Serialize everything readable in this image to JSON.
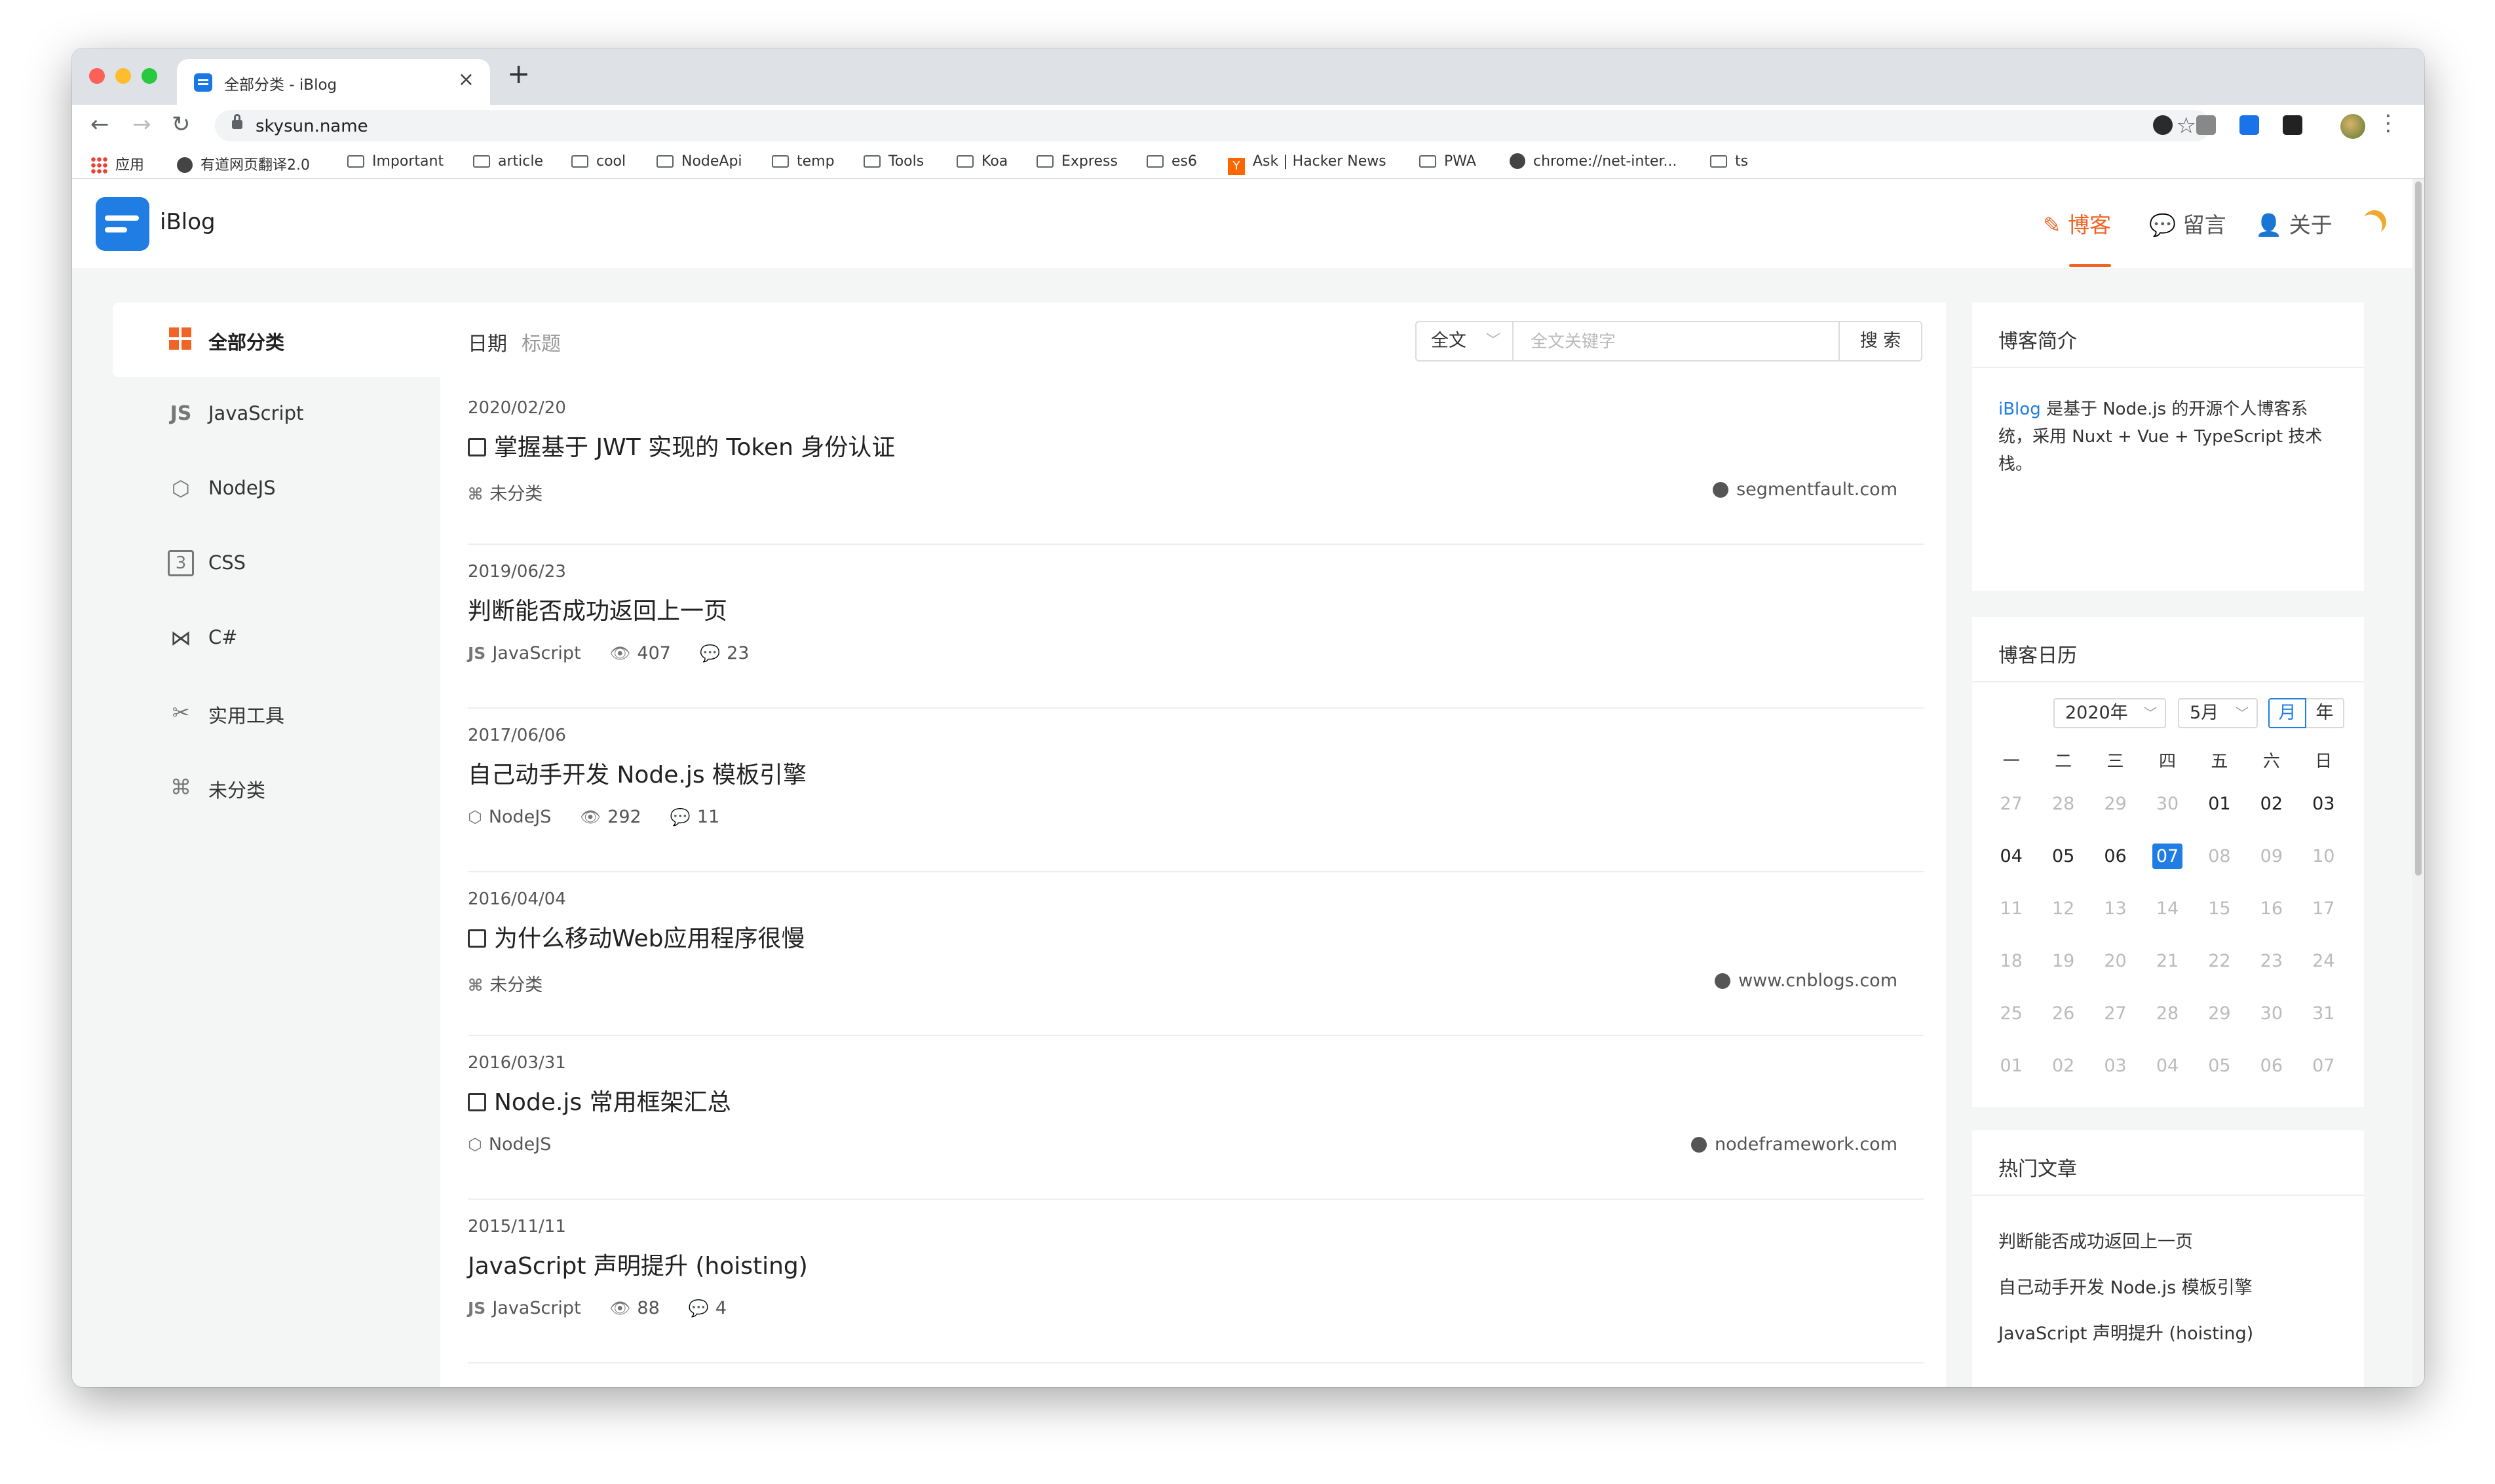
{
  "browser": {
    "tab_title": "全部分类 - iBlog",
    "url": "skysun.name",
    "bookmarks": [
      "应用",
      "有道网页翻译2.0",
      "Important",
      "article",
      "cool",
      "NodeApi",
      "temp",
      "Tools",
      "Koa",
      "Express",
      "es6",
      "Ask | Hacker News",
      "PWA",
      "chrome://net-inter...",
      "ts"
    ]
  },
  "header": {
    "brand": "iBlog",
    "nav": [
      {
        "label": "博客",
        "icon": "feather-icon",
        "active": true
      },
      {
        "label": "留言",
        "icon": "comment-icon",
        "active": false
      },
      {
        "label": "关于",
        "icon": "user-icon",
        "active": false
      }
    ],
    "theme_icon": "moon-icon"
  },
  "sidebar": {
    "items": [
      {
        "label": "全部分类",
        "icon": "grid-icon",
        "active": true
      },
      {
        "label": "JavaScript",
        "icon": "js-icon",
        "active": false
      },
      {
        "label": "NodeJS",
        "icon": "nodejs-icon",
        "active": false
      },
      {
        "label": "CSS",
        "icon": "css3-icon",
        "active": false
      },
      {
        "label": "C#",
        "icon": "visual-studio-icon",
        "active": false
      },
      {
        "label": "实用工具",
        "icon": "tools-icon",
        "active": false
      },
      {
        "label": "未分类",
        "icon": "grid-outline-icon",
        "active": false
      }
    ]
  },
  "list": {
    "col_date": "日期",
    "col_title": "标题",
    "search_scope": "全文",
    "search_placeholder": "全文关键字",
    "search_button": "搜 索",
    "articles": [
      {
        "date": "2020/02/20",
        "title": "掌握基于 JWT 实现的 Token 身份认证",
        "external": true,
        "category": "未分类",
        "category_icon": "grid-outline-icon",
        "views": "",
        "comments": "",
        "source": "segmentfault.com"
      },
      {
        "date": "2019/06/23",
        "title": "判断能否成功返回上一页",
        "external": false,
        "category": "JavaScript",
        "category_icon": "js-icon",
        "views": "407",
        "comments": "23",
        "source": ""
      },
      {
        "date": "2017/06/06",
        "title": "自己动手开发 Node.js 模板引擎",
        "external": false,
        "category": "NodeJS",
        "category_icon": "nodejs-icon",
        "views": "292",
        "comments": "11",
        "source": ""
      },
      {
        "date": "2016/04/04",
        "title": "为什么移动Web应用程序很慢",
        "external": true,
        "category": "未分类",
        "category_icon": "grid-outline-icon",
        "views": "",
        "comments": "",
        "source": "www.cnblogs.com"
      },
      {
        "date": "2016/03/31",
        "title": "Node.js 常用框架汇总",
        "external": true,
        "category": "NodeJS",
        "category_icon": "nodejs-icon",
        "views": "",
        "comments": "",
        "source": "nodeframework.com"
      },
      {
        "date": "2015/11/11",
        "title": "JavaScript 声明提升 (hoisting)",
        "external": false,
        "category": "JavaScript",
        "category_icon": "js-icon",
        "views": "88",
        "comments": "4",
        "source": ""
      }
    ]
  },
  "intro_card": {
    "title": "博客简介",
    "highlight": "iBlog",
    "text": " 是基于 Node.js 的开源个人博客系统，采用 Nuxt + Vue + TypeScript 技术栈。"
  },
  "calendar_card": {
    "title": "博客日历",
    "year": "2020年",
    "month": "5月",
    "mode_month": "月",
    "mode_year": "年",
    "weekdays": [
      "一",
      "二",
      "三",
      "四",
      "五",
      "六",
      "日"
    ],
    "days": [
      {
        "d": "27",
        "cur": false
      },
      {
        "d": "28",
        "cur": false
      },
      {
        "d": "29",
        "cur": false
      },
      {
        "d": "30",
        "cur": false
      },
      {
        "d": "01",
        "cur": true
      },
      {
        "d": "02",
        "cur": true
      },
      {
        "d": "03",
        "cur": true
      },
      {
        "d": "04",
        "cur": true
      },
      {
        "d": "05",
        "cur": true
      },
      {
        "d": "06",
        "cur": true
      },
      {
        "d": "07",
        "cur": true,
        "today": true
      },
      {
        "d": "08",
        "cur": false
      },
      {
        "d": "09",
        "cur": false
      },
      {
        "d": "10",
        "cur": false
      },
      {
        "d": "11",
        "cur": false
      },
      {
        "d": "12",
        "cur": false
      },
      {
        "d": "13",
        "cur": false
      },
      {
        "d": "14",
        "cur": false
      },
      {
        "d": "15",
        "cur": false
      },
      {
        "d": "16",
        "cur": false
      },
      {
        "d": "17",
        "cur": false
      },
      {
        "d": "18",
        "cur": false
      },
      {
        "d": "19",
        "cur": false
      },
      {
        "d": "20",
        "cur": false
      },
      {
        "d": "21",
        "cur": false
      },
      {
        "d": "22",
        "cur": false
      },
      {
        "d": "23",
        "cur": false
      },
      {
        "d": "24",
        "cur": false
      },
      {
        "d": "25",
        "cur": false
      },
      {
        "d": "26",
        "cur": false
      },
      {
        "d": "27",
        "cur": false
      },
      {
        "d": "28",
        "cur": false
      },
      {
        "d": "29",
        "cur": false
      },
      {
        "d": "30",
        "cur": false
      },
      {
        "d": "31",
        "cur": false
      },
      {
        "d": "01",
        "cur": false
      },
      {
        "d": "02",
        "cur": false
      },
      {
        "d": "03",
        "cur": false
      },
      {
        "d": "04",
        "cur": false
      },
      {
        "d": "05",
        "cur": false
      },
      {
        "d": "06",
        "cur": false
      },
      {
        "d": "07",
        "cur": false
      }
    ]
  },
  "hot_card": {
    "title": "热门文章",
    "items": [
      "判断能否成功返回上一页",
      "自己动手开发 Node.js 模板引擎",
      "JavaScript 声明提升 (hoisting)"
    ]
  },
  "colors": {
    "accent": "#f06527",
    "link": "#1f7de3"
  }
}
